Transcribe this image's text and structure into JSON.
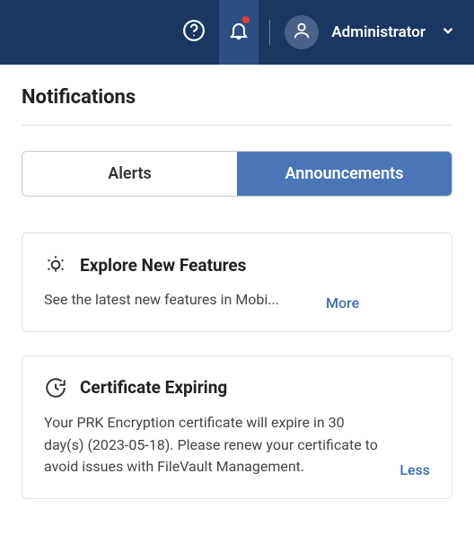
{
  "topbar": {
    "user_label": "Administrator"
  },
  "page": {
    "title": "Notifications"
  },
  "tabs": {
    "alerts": "Alerts",
    "announcements": "Announcements"
  },
  "cards": [
    {
      "title": "Explore New Features",
      "body": "See the latest new features in Mobi...",
      "link": "More"
    },
    {
      "title": "Certificate Expiring",
      "body": "Your PRK Encryption certificate will expire in 30 day(s) (2023-05-18). Please renew your certificate to avoid issues with FileVault Management.",
      "link": "Less"
    }
  ]
}
